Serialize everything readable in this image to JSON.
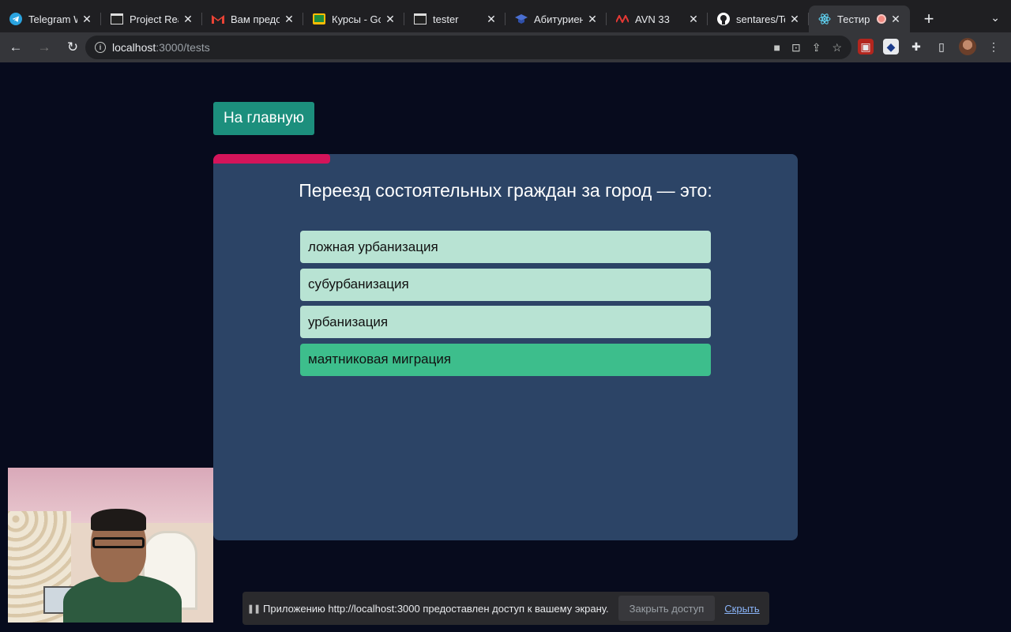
{
  "browser": {
    "tabs": [
      {
        "title": "Telegram W",
        "icon": "telegram-icon"
      },
      {
        "title": "Project Rea",
        "icon": "page-icon"
      },
      {
        "title": "Вам предо",
        "icon": "gmail-icon"
      },
      {
        "title": "Курсы - Go",
        "icon": "classroom-icon"
      },
      {
        "title": "tester",
        "icon": "page-icon"
      },
      {
        "title": "Абитуриен",
        "icon": "mortarboard-icon"
      },
      {
        "title": "AVN 33",
        "icon": "avn-icon"
      },
      {
        "title": "sentares/Te",
        "icon": "github-icon"
      },
      {
        "title": "Тестир",
        "icon": "react-icon",
        "active": true,
        "recording": true
      }
    ],
    "url_host": "localhost",
    "url_path": ":3000/tests"
  },
  "page": {
    "home_button": "На главную",
    "progress_fraction": 0.2,
    "question": "Переезд состоятельных граждан за город — это:",
    "answers": [
      "ложная урбанизация",
      "субурбанизация",
      "урбанизация",
      "маятниковая миграция"
    ],
    "hovered_answer_index": 3,
    "colors": {
      "background": "#070b1d",
      "card": "#2c4466",
      "progress": "#d4145a",
      "answer": "#b8e3d3",
      "answer_hover": "#3dbe8c",
      "home_button": "#1c8f7d"
    }
  },
  "share_bar": {
    "message": "Приложению http://localhost:3000 предоставлен доступ к вашему экрану.",
    "stop_label": "Закрыть доступ",
    "hide_label": "Скрыть"
  }
}
